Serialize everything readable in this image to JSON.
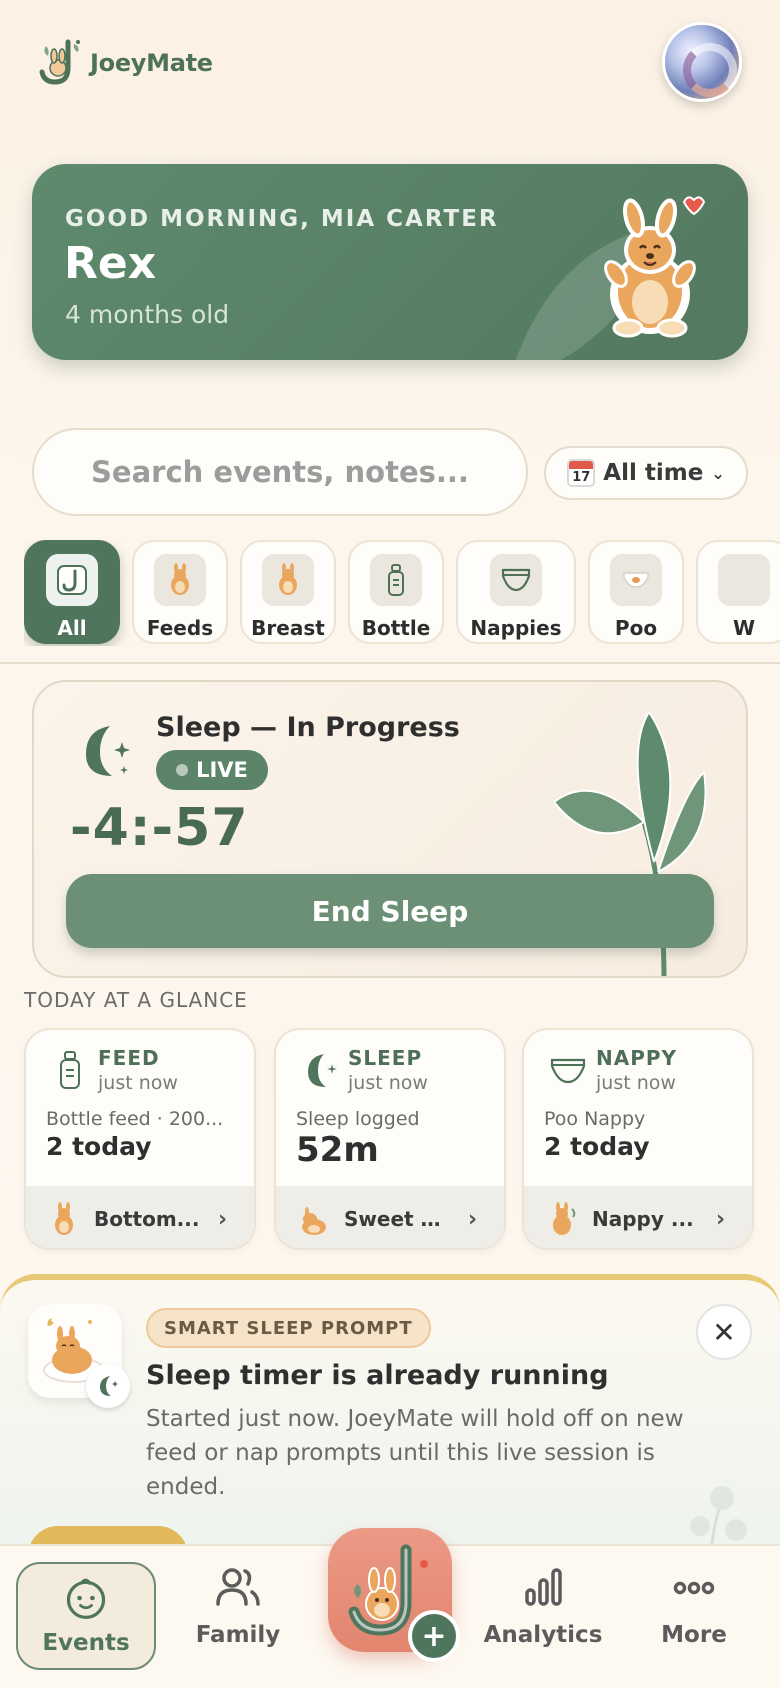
{
  "app": {
    "name": "JoeyMate"
  },
  "greeting": {
    "label": "GOOD MORNING, MIA CARTER",
    "baby_name": "Rex",
    "age": "4 months old"
  },
  "search": {
    "placeholder": "Search events, notes..."
  },
  "date_filter": {
    "icon": "calendar-icon",
    "calendar_day": "17",
    "label": "All time"
  },
  "categories": [
    {
      "label": "All",
      "icon": "joey-logo-icon",
      "active": true
    },
    {
      "label": "Feeds",
      "icon": "kangaroo-icon"
    },
    {
      "label": "Breast",
      "icon": "kangaroo-icon"
    },
    {
      "label": "Bottle",
      "icon": "bottle-icon"
    },
    {
      "label": "Nappies",
      "icon": "nappy-icon"
    },
    {
      "label": "Poo",
      "icon": "poo-icon"
    },
    {
      "label": "W",
      "icon": "more-category-icon"
    }
  ],
  "sleep_session": {
    "title": "Sleep — In Progress",
    "badge": "LIVE",
    "timer": "-4:-57",
    "button": "End Sleep"
  },
  "glance": {
    "title": "TODAY AT A GLANCE",
    "cards": [
      {
        "type": "FEED",
        "time": "just now",
        "description": "Bottle feed · 200...",
        "value": "2 today",
        "footer": "Bottom...",
        "icon": "bottle-icon"
      },
      {
        "type": "SLEEP",
        "time": "just now",
        "description": "Sleep logged",
        "value": "52m",
        "footer": "Sweet d...",
        "icon": "moon-icon"
      },
      {
        "type": "NAPPY",
        "time": "just now",
        "description": "Poo Nappy",
        "value": "2 today",
        "footer": "Nappy ...",
        "icon": "nappy-icon"
      }
    ]
  },
  "smart_prompt": {
    "badge": "SMART SLEEP PROMPT",
    "title": "Sleep timer is already running",
    "body": "Started just now. JoeyMate will hold off on new feed or nap prompts until this live session is ended.",
    "close_icon": "close-icon"
  },
  "nav": {
    "items": [
      {
        "label": "Events",
        "icon": "baby-face-icon",
        "active": true
      },
      {
        "label": "Family",
        "icon": "people-icon"
      },
      {
        "label": "Analytics",
        "icon": "bar-chart-icon"
      },
      {
        "label": "More",
        "icon": "dots-icon"
      }
    ],
    "fab_icon": "kangaroo-add-icon",
    "fab_plus": "+"
  },
  "colors": {
    "primary_green": "#4f755c",
    "accent_coral": "#e2856f",
    "accent_gold": "#e1b95b",
    "background": "#fdf6ec"
  }
}
